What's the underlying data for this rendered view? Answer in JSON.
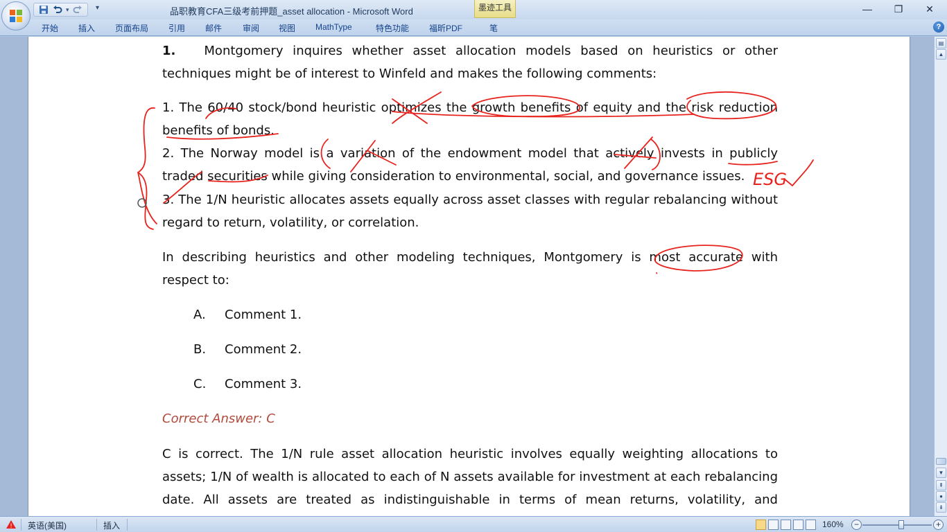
{
  "window": {
    "title": "品职教育CFA三级考前押题_asset allocation - Microsoft Word",
    "contextual_tab": "墨迹工具",
    "minimize": "—",
    "restore": "❐",
    "close": "✕"
  },
  "ribbon": {
    "tabs": [
      "开始",
      "插入",
      "页面布局",
      "引用",
      "邮件",
      "审阅",
      "视图",
      "MathType",
      "特色功能",
      "福昕PDF",
      "笔"
    ],
    "help": "?"
  },
  "document": {
    "q_number": "1.",
    "q_intro": "Montgomery inquires whether asset allocation models based on heuristics or other techniques might be of interest to Winfeld and makes the following comments:",
    "comment1": "1. The 60/40 stock/bond heuristic optimizes the growth benefits of equity and the risk reduction benefits of bonds.",
    "comment2": "2. The Norway model is a variation of the endowment model that actively invests in publicly traded securities while giving consideration to environmental, social, and governance issues.",
    "comment3": "3. The 1/N heuristic allocates assets equally across asset classes with regular rebalancing without regard to return, volatility, or correlation.",
    "question": "In describing heuristics and other modeling techniques, Montgomery is most accurate with respect to:",
    "options": [
      {
        "letter": "A.",
        "text": "Comment 1."
      },
      {
        "letter": "B.",
        "text": "Comment 2."
      },
      {
        "letter": "C.",
        "text": "Comment 3."
      }
    ],
    "correct_answer": "Correct Answer:  C",
    "explanation": "C is correct. The 1/N rule asset allocation heuristic involves equally weighting allocations to assets; 1/N of wealth is allocated to each of N assets available for investment at each rebalancing date. All assets are treated as indistinguishable in terms of mean returns, volatility, and correlations.",
    "ink_note": "ESG"
  },
  "statusbar": {
    "language": "英语(美国)",
    "insert_mode": "插入",
    "zoom": "160%",
    "zoom_out": "−",
    "zoom_in": "+"
  },
  "colors": {
    "ink": "#e8221d",
    "answer": "#b04a3a",
    "ribbon_text": "#15428b"
  }
}
